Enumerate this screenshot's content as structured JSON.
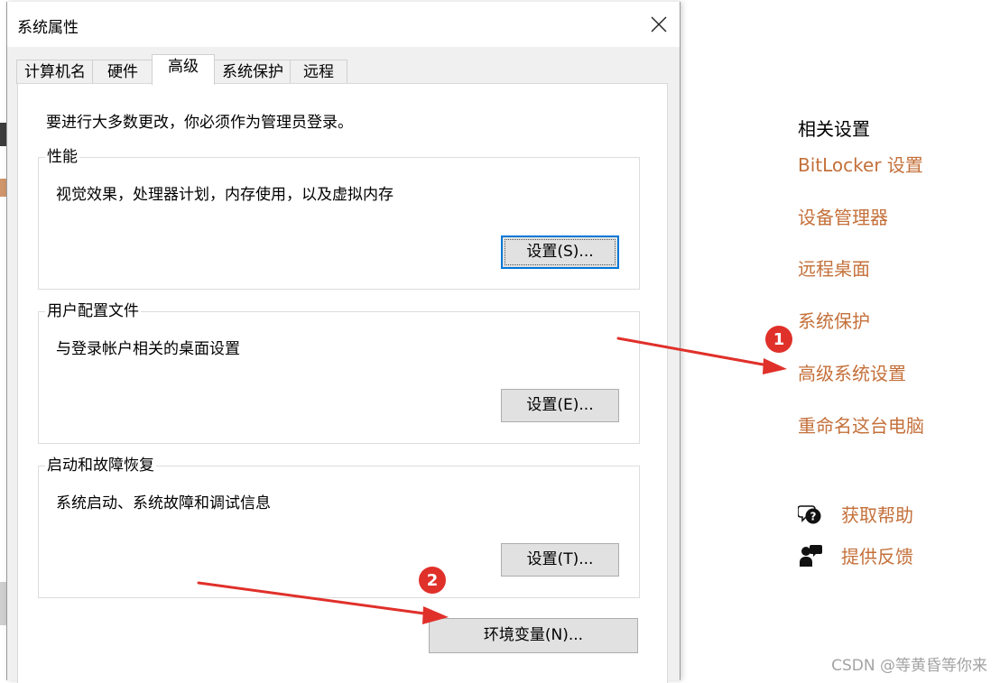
{
  "dialog": {
    "title": "系统属性",
    "tabs": [
      {
        "label": "计算机名"
      },
      {
        "label": "硬件"
      },
      {
        "label": "高级"
      },
      {
        "label": "系统保护"
      },
      {
        "label": "远程"
      }
    ],
    "active_tab": "高级",
    "admin_note": "要进行大多数更改，你必须作为管理员登录。",
    "groups": {
      "performance": {
        "label": "性能",
        "description": "视觉效果，处理器计划，内存使用，以及虚拟内存",
        "button": "设置(S)..."
      },
      "user_profiles": {
        "label": "用户配置文件",
        "description": "与登录帐户相关的桌面设置",
        "button": "设置(E)..."
      },
      "startup_recovery": {
        "label": "启动和故障恢复",
        "description": "系统启动、系统故障和调试信息",
        "button": "设置(T)..."
      }
    },
    "env_button": "环境变量(N)..."
  },
  "settings_pane": {
    "related_title": "相关设置",
    "links": [
      {
        "label": "BitLocker 设置"
      },
      {
        "label": "设备管理器"
      },
      {
        "label": "远程桌面"
      },
      {
        "label": "系统保护"
      },
      {
        "label": "高级系统设置"
      },
      {
        "label": "重命名这台电脑"
      }
    ],
    "help": {
      "label": "获取帮助",
      "icon": "help-chat-icon"
    },
    "feedback": {
      "label": "提供反馈",
      "icon": "feedback-person-icon"
    },
    "link_color": "#c4703a"
  },
  "annotations": {
    "badge_1": "1",
    "badge_2": "2",
    "arrow_color": "#e0302a"
  },
  "watermark": "CSDN @等黄昏等你来"
}
